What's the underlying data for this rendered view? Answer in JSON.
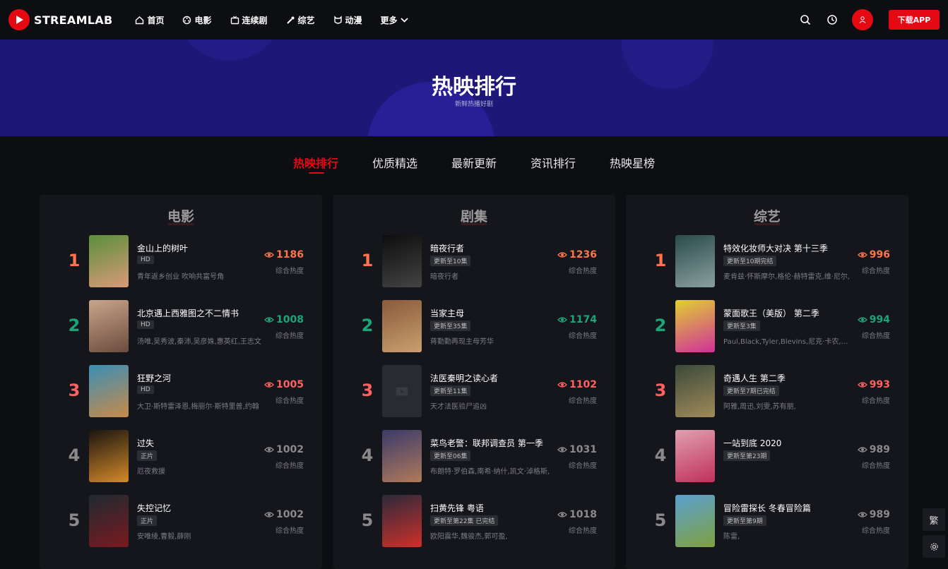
{
  "header": {
    "brand": "STREAMLAB",
    "nav": [
      {
        "label": "首页",
        "icon": "home-icon"
      },
      {
        "label": "电影",
        "icon": "film-reel-icon"
      },
      {
        "label": "连续剧",
        "icon": "tv-icon"
      },
      {
        "label": "综艺",
        "icon": "magic-icon"
      },
      {
        "label": "动漫",
        "icon": "anime-icon"
      },
      {
        "label": "更多",
        "icon": "chevron-down-icon"
      }
    ],
    "download_label": "下载APP",
    "accent": "#e50914"
  },
  "banner": {
    "title": "热映排行",
    "subtitle": "新鲜热播好剧"
  },
  "tabs": [
    "热映排行",
    "优质精选",
    "最新更新",
    "资讯排行",
    "热映星榜"
  ],
  "active_tab": 0,
  "heat_label": "综合热度",
  "panels": [
    {
      "title": "电影",
      "items": [
        {
          "rank": "1",
          "title": "金山上的树叶",
          "badge": "HD",
          "desc": "青年返乡创业 吹响共富号角",
          "heat": "1186",
          "poster": [
            "#5a8f3a",
            "#d99a7a"
          ]
        },
        {
          "rank": "2",
          "title": "北京遇上西雅图之不二情书",
          "badge": "HD",
          "desc": "汤唯,吴秀波,秦沛,吴彦姝,惠英红,王志文",
          "heat": "1008",
          "poster": [
            "#c9a58a",
            "#6b4b3e"
          ]
        },
        {
          "rank": "3",
          "title": "狂野之河",
          "badge": "HD",
          "desc": "大卫·斯特雷泽恩,梅丽尔·斯特里普,约翰",
          "heat": "1005",
          "poster": [
            "#3a8fb5",
            "#c78a4a"
          ]
        },
        {
          "rank": "4",
          "title": "过失",
          "badge": "正片",
          "desc": "厄夜救援",
          "heat": "1002",
          "poster": [
            "#1a1410",
            "#d48a2a"
          ]
        },
        {
          "rank": "5",
          "title": "失控记忆",
          "badge": "正片",
          "desc": "安唯绫,曹毅,薛刚",
          "heat": "1002",
          "poster": [
            "#1e2a30",
            "#7a1a20"
          ]
        }
      ]
    },
    {
      "title": "剧集",
      "items": [
        {
          "rank": "1",
          "title": "暗夜行者",
          "badge": "更新至10集",
          "desc": "暗夜行者",
          "heat": "1236",
          "poster": [
            "#0d0d0f",
            "#444"
          ]
        },
        {
          "rank": "2",
          "title": "当家主母",
          "badge": "更新至35集",
          "desc": "蒋勤勤再现主母芳华",
          "heat": "1174",
          "poster": [
            "#8a5a3a",
            "#c9a070"
          ]
        },
        {
          "rank": "3",
          "title": "法医秦明之读心者",
          "badge": "更新至11集",
          "desc": "天才法医验尸追凶",
          "heat": "1102",
          "poster": null
        },
        {
          "rank": "4",
          "title": "菜鸟老警：联邦调查员 第一季",
          "badge": "更新至06集",
          "desc": "布朗特·罗伯森,南希·纳什,凯文·淖格斯,",
          "heat": "1031",
          "poster": [
            "#3a3a6a",
            "#b07a5a"
          ]
        },
        {
          "rank": "5",
          "title": "扫黄先锋 粤语",
          "badge": "更新至第22集 已完结",
          "desc": "欧阳震华,魏骏杰,郭可盈,",
          "heat": "1018",
          "poster": [
            "#2a2a3a",
            "#d0302a"
          ]
        }
      ]
    },
    {
      "title": "综艺",
      "items": [
        {
          "rank": "1",
          "title": "特效化妆师大对决 第十三季",
          "badge": "更新至10期完结",
          "desc": "麦肯兹·怀斯摩尔,格伦·赫特雷克,维·尼尔,",
          "heat": "996",
          "poster": [
            "#2a4a4a",
            "#8aa0a0"
          ]
        },
        {
          "rank": "2",
          "title": "蒙面歌王（美版） 第二季",
          "badge": "更新至3集",
          "desc": "Paul,Black,Tyler,Blevins,尼克·卡农,马力",
          "heat": "994",
          "poster": [
            "#e0d030",
            "#d0309a"
          ]
        },
        {
          "rank": "3",
          "title": "奇遇人生 第二季",
          "badge": "更新至7期已完结",
          "desc": "阿雅,周迅,刘雯,苏有朋,",
          "heat": "993",
          "poster": [
            "#3a4a3a",
            "#a08a5a"
          ]
        },
        {
          "rank": "4",
          "title": "一站到底 2020",
          "badge": "更新至第23期",
          "desc": "",
          "heat": "989",
          "poster": [
            "#e0a0b0",
            "#c0305a"
          ]
        },
        {
          "rank": "5",
          "title": "冒险雷探长 冬春冒险篇",
          "badge": "更新至第9期",
          "desc": "陈雷,",
          "heat": "989",
          "poster": [
            "#5aa0d0",
            "#80a040"
          ]
        }
      ]
    }
  ],
  "side": {
    "traditional": "繁"
  }
}
